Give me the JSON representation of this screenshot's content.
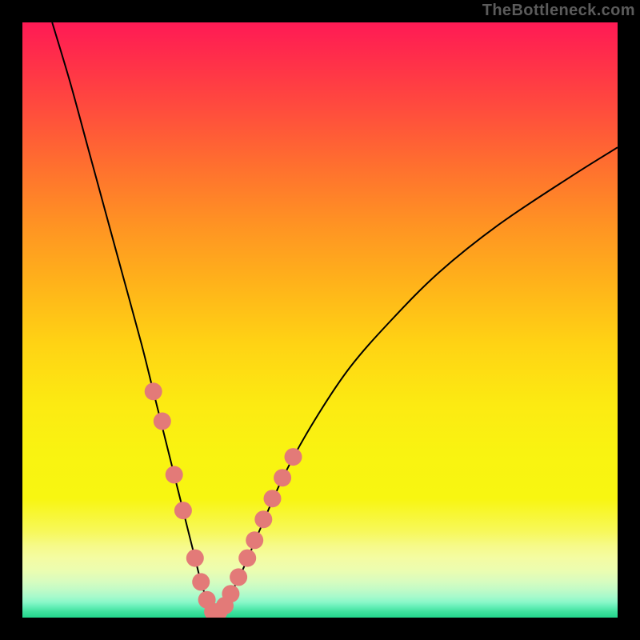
{
  "watermark": {
    "text": "TheBottleneck.com"
  },
  "colors": {
    "curve": "#000000",
    "dot_fill": "#e37a78",
    "dot_stroke": "#c95a56"
  },
  "chart_data": {
    "type": "line",
    "title": "",
    "xlabel": "",
    "ylabel": "",
    "xlim": [
      0,
      100
    ],
    "ylim": [
      0,
      100
    ],
    "grid": false,
    "legend": false,
    "annotations": [],
    "series": [
      {
        "name": "bottleneck-curve",
        "x": [
          5,
          8,
          11,
          14,
          17,
          20,
          22,
          24,
          26,
          28,
          29,
          30,
          31,
          32,
          33,
          34,
          35,
          37,
          40,
          44,
          49,
          55,
          62,
          70,
          80,
          92,
          100
        ],
        "y": [
          100,
          90,
          79,
          68,
          57,
          46,
          38,
          30,
          22,
          14,
          10,
          6,
          3,
          1,
          1,
          2,
          4,
          8,
          15,
          24,
          33,
          42,
          50,
          58,
          66,
          74,
          79
        ]
      }
    ],
    "dots": {
      "name": "highlight-dots",
      "x": [
        22,
        23.5,
        25.5,
        27,
        29,
        30,
        31,
        32,
        33,
        34,
        35,
        36.3,
        37.8,
        39,
        40.5,
        42,
        43.7,
        45.5
      ],
      "y": [
        38,
        33,
        24,
        18,
        10,
        6,
        3,
        1,
        1,
        2,
        4,
        6.8,
        10,
        13,
        16.5,
        20,
        23.5,
        27
      ]
    }
  }
}
